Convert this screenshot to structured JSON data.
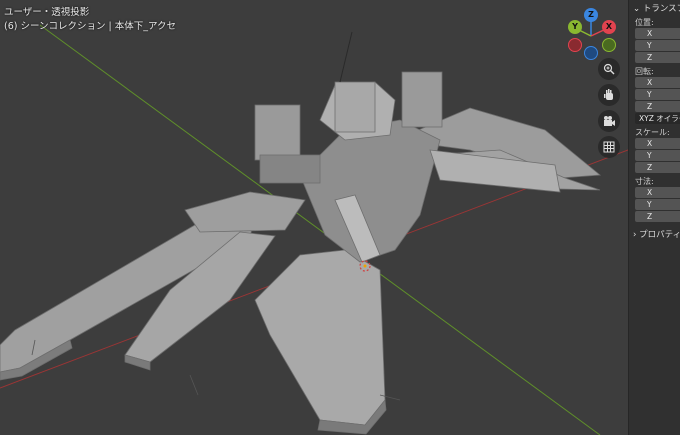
{
  "viewport": {
    "title": "ユーザー・透視投影",
    "collection": "(6) シーンコレクション | 本体下_アクセ"
  },
  "gizmo": {
    "axis_z": "Z",
    "axis_y": "Y",
    "axis_x": "X",
    "colors": {
      "x": "#e2434f",
      "y": "#8ab830",
      "z": "#3a86e0"
    }
  },
  "nav_icons": [
    "zoom-icon",
    "hand-icon",
    "camera-icon",
    "grid-icon"
  ],
  "npanel": {
    "header": "トランスフォーム",
    "location_label": "位置:",
    "location_axes": [
      "X",
      "Y",
      "Z"
    ],
    "rotation_label": "回転:",
    "rotation_axes": [
      "X",
      "Y",
      "Z"
    ],
    "rotation_mode": "XYZ オイラー角",
    "scale_label": "スケール:",
    "scale_axes": [
      "X",
      "Y",
      "Z"
    ],
    "dimensions_label": "寸法:",
    "dimensions_axes": [
      "X",
      "Y",
      "Z"
    ],
    "properties_header": "プロパティ"
  },
  "colors": {
    "background": "#3d3d3d",
    "x_axis": "#a83a3a",
    "y_axis": "#6a9a2a",
    "model": "#9a9a9a"
  }
}
